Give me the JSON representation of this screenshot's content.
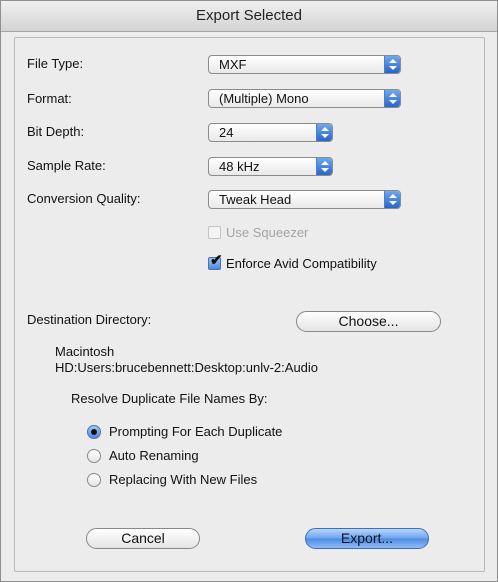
{
  "dialog": {
    "title": "Export Selected"
  },
  "fields": {
    "file_type": {
      "label": "File Type:",
      "value": "MXF"
    },
    "format": {
      "label": "Format:",
      "value": "(Multiple) Mono"
    },
    "bit_depth": {
      "label": "Bit Depth:",
      "value": "24"
    },
    "sample_rate": {
      "label": "Sample Rate:",
      "value": "48 kHz"
    },
    "conversion_quality": {
      "label": "Conversion Quality:",
      "value": "Tweak Head"
    }
  },
  "options": {
    "use_squeezer": {
      "label": "Use Squeezer",
      "checked": false,
      "enabled": false
    },
    "enforce_avid": {
      "label": "Enforce Avid Compatibility",
      "checked": true,
      "enabled": true
    }
  },
  "destination": {
    "label": "Destination Directory:",
    "choose_label": "Choose...",
    "path_line1": "Macintosh",
    "path_line2": "HD:Users:brucebennett:Desktop:unlv-2:Audio"
  },
  "duplicates": {
    "label": "Resolve Duplicate File Names By:",
    "options": [
      {
        "label": "Prompting For Each Duplicate",
        "selected": true
      },
      {
        "label": "Auto Renaming",
        "selected": false
      },
      {
        "label": "Replacing With New Files",
        "selected": false
      }
    ]
  },
  "buttons": {
    "cancel": "Cancel",
    "export": "Export..."
  }
}
